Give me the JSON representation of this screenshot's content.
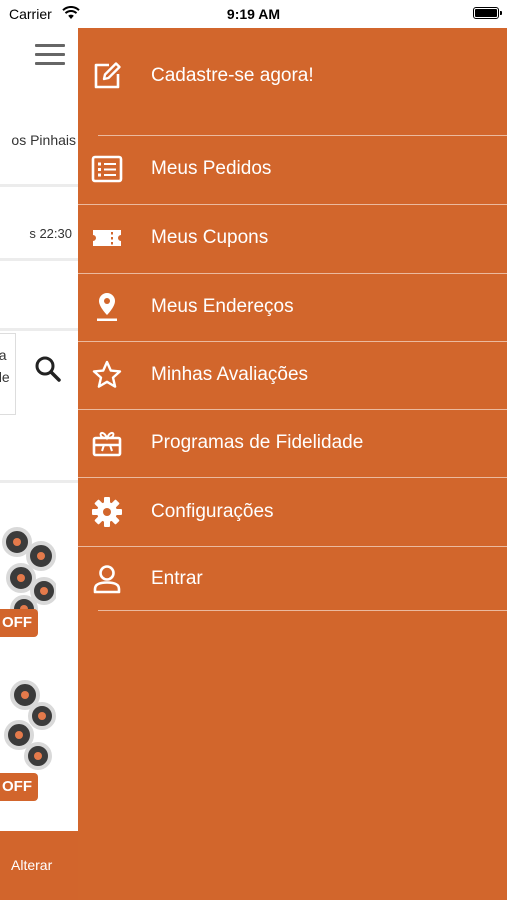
{
  "status_bar": {
    "carrier": "Carrier",
    "time": "9:19 AM"
  },
  "background": {
    "address_fragment": "os Pinhais",
    "hours_fragment": "s 22:30",
    "search_fragment_1": "na",
    "search_fragment_2": "ide",
    "discount_label_1": "OFF",
    "discount_label_2": "OFF",
    "bottom_action": "Alterar"
  },
  "drawer": {
    "signup_label": "Cadastre-se agora!",
    "items": [
      {
        "label": "Meus Pedidos",
        "icon": "order-list-icon"
      },
      {
        "label": "Meus Cupons",
        "icon": "ticket-icon"
      },
      {
        "label": "Meus Endereços",
        "icon": "map-pin-icon"
      },
      {
        "label": "Minhas Avaliações",
        "icon": "star-icon"
      },
      {
        "label": "Programas de Fidelidade",
        "icon": "gift-icon"
      },
      {
        "label": "Configurações",
        "icon": "gear-icon"
      },
      {
        "label": "Entrar",
        "icon": "user-icon"
      }
    ],
    "colors": {
      "background": "#D2662C",
      "text": "#FFFFFF"
    }
  }
}
